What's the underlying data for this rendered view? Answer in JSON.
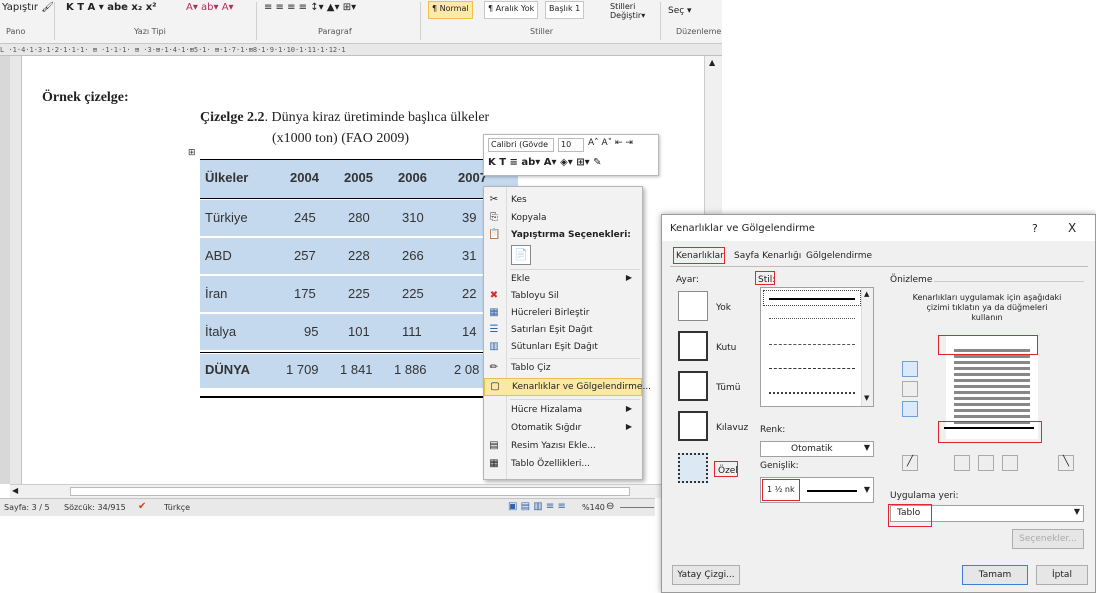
{
  "ribbon": {
    "paste": "Yapıştır",
    "font_tools": "K  T  A ▾ abe  x₂  x²",
    "color_tools": "A▾  ab▾  A▾",
    "para_tools": "≡  ≡  ≡  ≡   ↕▾   ▲▾  ⊞▾",
    "style_normal": "¶ Normal",
    "style_nospace": "¶ Aralık Yok",
    "style_heading": "Başlık 1",
    "change_styles": "Stilleri\nDeğiştir▾",
    "select": "Seç ▾",
    "groups": {
      "clipboard": "Pano",
      "font": "Yazı Tipi",
      "paragraph": "Paragraf",
      "styles": "Stiller",
      "editing": "Düzenleme"
    }
  },
  "ruler": "L  ·1·4·1·3·1·2·1·1·1·  ⊞  ·1·1·1·  ⊞  ·3·⊞·1·4·1·⊞5·1·  ⊞·1·7·1·⊞8·1·9·1·10·1·11·1·12·1",
  "document": {
    "heading": "Örnek çizelge:",
    "caption_line1_bold": "Çizelge 2.2",
    "caption_line1_rest": ". Dünya kiraz üretiminde başlıca ülkeler",
    "caption_line2": "(x1000 ton) (FAO 2009)",
    "table": {
      "headers": [
        "Ülkeler",
        "2004",
        "2005",
        "2006",
        "2007"
      ],
      "rows": [
        [
          "Türkiye",
          "245",
          "280",
          "310",
          "39"
        ],
        [
          "ABD",
          "257",
          "228",
          "266",
          "31"
        ],
        [
          "İran",
          "175",
          "225",
          "225",
          "22"
        ],
        [
          "İtalya",
          "95",
          "101",
          "111",
          "14"
        ]
      ],
      "total": [
        "DÜNYA",
        "1 709",
        "1 841",
        "1 886",
        "2 08"
      ]
    }
  },
  "mini_toolbar": {
    "font_name": "Calibri (Gövde",
    "font_size": "10",
    "row2": "K  T  ≡  ab▾  A▾  ◈▾  ⊞▾  ✎"
  },
  "context_menu": {
    "items": [
      {
        "label": "Kes",
        "icon": "✂"
      },
      {
        "label": "Kopyala",
        "icon": "⎘"
      },
      {
        "label": "Yapıştırma Seçenekleri:",
        "icon": "📋"
      },
      {
        "label": "Ekle",
        "icon": ""
      },
      {
        "label": "Tabloyu Sil",
        "icon": "✖"
      },
      {
        "label": "Hücreleri Birleştir",
        "icon": "▦"
      },
      {
        "label": "Satırları Eşit Dağıt",
        "icon": "☰"
      },
      {
        "label": "Sütunları Eşit Dağıt",
        "icon": "▥"
      },
      {
        "label": "Tablo Çiz",
        "icon": "✏"
      },
      {
        "label": "Kenarlıklar ve Gölgelendirme...",
        "icon": "▢"
      },
      {
        "label": "Hücre Hizalama",
        "icon": ""
      },
      {
        "label": "Otomatik Sığdır",
        "icon": ""
      },
      {
        "label": "Resim Yazısı Ekle...",
        "icon": "▤"
      },
      {
        "label": "Tablo Özellikleri...",
        "icon": "▦"
      }
    ]
  },
  "status_bar": {
    "page": "Sayfa: 3 / 5",
    "words": "Sözcük: 34/915",
    "language": "Türkçe",
    "zoom": "%140"
  },
  "dialog": {
    "title": "Kenarlıklar ve Gölgelendirme",
    "help": "?",
    "close": "X",
    "tabs": [
      "Kenarlıklar",
      "Sayfa Kenarlığı",
      "Gölgelendirme"
    ],
    "setting_label": "Ayar:",
    "settings": [
      "Yok",
      "Kutu",
      "Tümü",
      "Kılavuz",
      "Özel"
    ],
    "style_label": "Stil:",
    "color_label": "Renk:",
    "color_value": "Otomatik",
    "width_label": "Genişlik:",
    "width_value": "1 ½ nk",
    "preview_label": "Önizleme",
    "preview_hint": "Kenarlıkları uygulamak için aşağıdaki çizimi tıklatın ya da düğmeleri kullanın",
    "apply_label": "Uygulama yeri:",
    "apply_value": "Tablo",
    "options_button": "Seçenekler...",
    "horizontal_line": "Yatay Çizgi...",
    "ok": "Tamam",
    "cancel": "İptal",
    "accent": "#e0262e",
    "select_highlight": "#c4d9ee"
  }
}
